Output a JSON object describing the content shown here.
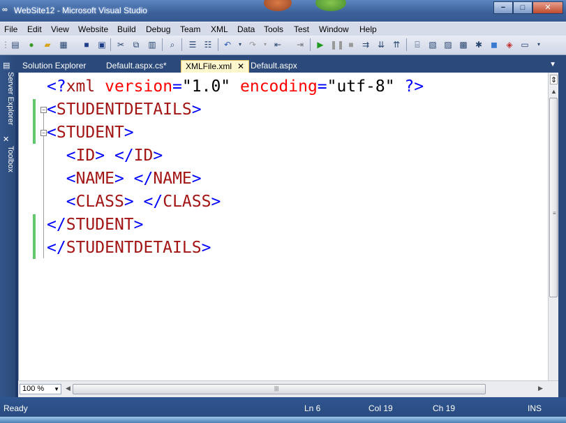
{
  "window": {
    "title": "WebSite12 - Microsoft Visual Studio",
    "controls": {
      "minimize": "−",
      "maximize": "□",
      "close": "✕"
    }
  },
  "menu": [
    "File",
    "Edit",
    "View",
    "Website",
    "Build",
    "Debug",
    "Team",
    "XML",
    "Data",
    "Tools",
    "Test",
    "Window",
    "Help"
  ],
  "toolbar_icons": [
    "new-project-icon",
    "add-item-icon",
    "open-icon",
    "add-new-item-icon",
    "save-icon",
    "save-all-icon",
    "cut-icon",
    "copy-icon",
    "paste-icon",
    "find-icon",
    "comment-icon",
    "uncomment-icon",
    "undo-icon",
    "redo-icon",
    "navigate-icon",
    "navigate-forward-icon",
    "start-debug-icon",
    "pause-icon",
    "stop-icon",
    "step-icon",
    "solution-explorer-icon",
    "properties-icon",
    "object-browser-icon",
    "toolbox-icon",
    "extension-icon",
    "start-page-icon",
    "options-icon"
  ],
  "left_dock": {
    "server_explorer": "Server Explorer",
    "toolbox": "Toolbox"
  },
  "tabs": [
    {
      "label": "Solution Explorer",
      "active": false
    },
    {
      "label": "Default.aspx.cs*",
      "active": false
    },
    {
      "label": "XMLFile.xml",
      "active": true
    },
    {
      "label": "Default.aspx",
      "active": false
    }
  ],
  "code": {
    "line1": {
      "open": "<?",
      "kw": "xml",
      "attr1": "version",
      "eq1": "=",
      "val1": "\"1.0\"",
      "attr2": "encoding",
      "eq2": "=",
      "val2": "\"utf-8\"",
      "close": "?>"
    },
    "line2": {
      "lt": "<",
      "tag": "STUDENTDETAILS",
      "gt": ">"
    },
    "line3": {
      "lt": "<",
      "tag": "STUDENT",
      "gt": ">"
    },
    "line4": {
      "o_lt": "<",
      "o_tag": "ID",
      "o_gt": ">",
      "c_lt": "</",
      "c_tag": "ID",
      "c_gt": ">"
    },
    "line5": {
      "o_lt": "<",
      "o_tag": "NAME",
      "o_gt": ">",
      "c_lt": "</",
      "c_tag": "NAME",
      "c_gt": ">"
    },
    "line6": {
      "o_lt": "<",
      "o_tag": "CLASS",
      "o_gt": ">",
      "c_lt": "</",
      "c_tag": "CLASS",
      "c_gt": ">"
    },
    "line7": {
      "lt": "</",
      "tag": "STUDENT",
      "gt": ">"
    },
    "line8": {
      "lt": "</",
      "tag": "STUDENTDETAILS",
      "gt": ">"
    }
  },
  "zoom": "100 %",
  "status": {
    "state": "Ready",
    "ln": "Ln 6",
    "col": "Col 19",
    "ch": "Ch 19",
    "mode": "INS"
  },
  "colors": {
    "keyword": "#0000ff",
    "tag": "#a31515",
    "attribute": "#ff0000",
    "change_bar": "#63c86b",
    "chrome": "#2b4a7b"
  }
}
